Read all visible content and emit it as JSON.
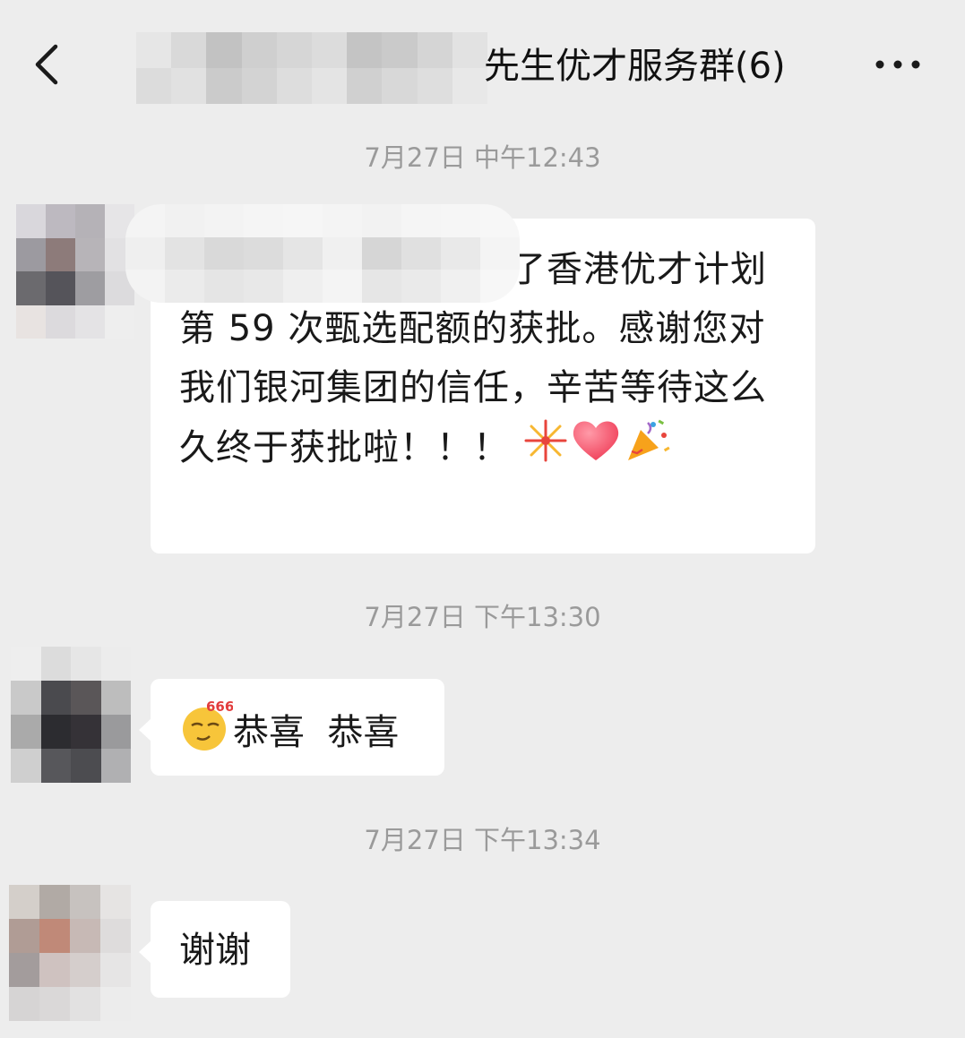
{
  "header": {
    "back_icon": "chevron-left-icon",
    "title": "先生优才服务群(6)",
    "more_icon": "more-dots-icon"
  },
  "messages": [
    {
      "time": "7月27日 中午12:43",
      "text": "，您好，恭喜您获得了香港优才计划第 59 次甄选配额的获批。感谢您对我们银河集团的信任，辛苦等待这么久终于获批啦！！！",
      "emojis": [
        "fireworks-icon",
        "heart-icon",
        "party-popper-icon"
      ]
    },
    {
      "time": "7月27日 下午13:30",
      "emoji": "666-emoji-icon",
      "text": "恭喜  恭喜"
    },
    {
      "time": "7月27日 下午13:34",
      "text": "谢谢"
    }
  ]
}
